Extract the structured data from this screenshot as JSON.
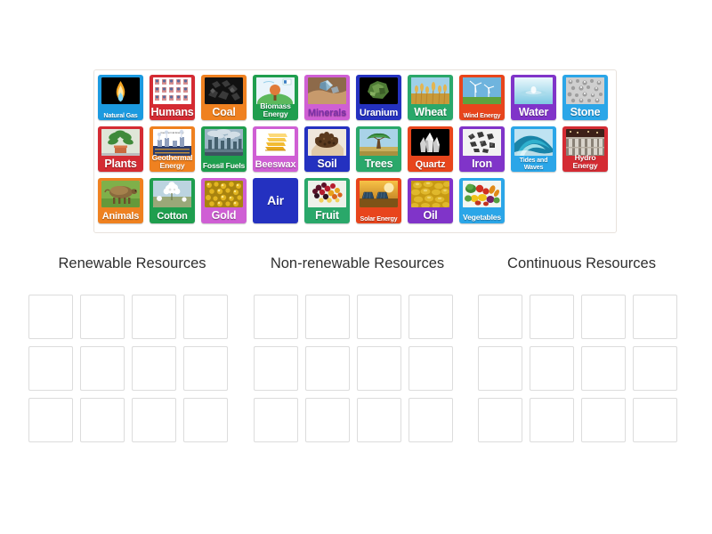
{
  "activity": {
    "type": "group-sort",
    "tray_rows": 3,
    "tray_columns": 10
  },
  "tiles": [
    {
      "label": "Natural Gas",
      "bg": "#1b9ae0",
      "fg": "#ffffff",
      "size": "xs",
      "icon": "gas-flame-icon",
      "row": 0
    },
    {
      "label": "Humans",
      "bg": "#d42b33",
      "fg": "#ffffff",
      "size": "lg",
      "icon": "people-grid-icon",
      "row": 0
    },
    {
      "label": "Coal",
      "bg": "#ef8120",
      "fg": "#ffffff",
      "size": "lg",
      "icon": "coal-lumps-icon",
      "row": 0
    },
    {
      "label": "Biomass Energy",
      "bg": "#1f9e4e",
      "fg": "#ffffff",
      "size": "two",
      "icon": "biomass-diagram-icon",
      "row": 0
    },
    {
      "label": "Minerals",
      "bg": "#cf5fd4",
      "fg": "#7b2fa8",
      "size": "md",
      "icon": "minerals-hand-icon",
      "row": 0
    },
    {
      "label": "Uranium",
      "bg": "#2431c0",
      "fg": "#ffffff",
      "size": "md",
      "icon": "uranium-ore-icon",
      "row": 0
    },
    {
      "label": "Wheat",
      "bg": "#2aa86a",
      "fg": "#ffffff",
      "size": "lg",
      "icon": "wheat-field-icon",
      "row": 0
    },
    {
      "label": "Wind Energy",
      "bg": "#e8451c",
      "fg": "#ffffff",
      "size": "xs",
      "icon": "wind-turbine-icon",
      "row": 0
    },
    {
      "label": "Water",
      "bg": "#8034c9",
      "fg": "#ffffff",
      "size": "lg",
      "icon": "water-drop-icon",
      "row": 0
    },
    {
      "label": "Stone",
      "bg": "#2ba6e8",
      "fg": "#ffffff",
      "size": "lg",
      "icon": "stone-gravel-icon",
      "row": 0
    },
    {
      "label": "Plants",
      "bg": "#d42b33",
      "fg": "#ffffff",
      "size": "lg",
      "icon": "potted-plant-icon",
      "row": 1
    },
    {
      "label": "Geothermal Energy",
      "bg": "#ef8120",
      "fg": "#ffffff",
      "size": "two",
      "icon": "geothermal-plant-icon",
      "row": 1
    },
    {
      "label": "Fossil Fuels",
      "bg": "#1f9e4e",
      "fg": "#ffffff",
      "size": "sm",
      "icon": "smokestacks-icon",
      "row": 1
    },
    {
      "label": "Beeswax",
      "bg": "#cf5fd4",
      "fg": "#ffffff",
      "size": "md",
      "icon": "beeswax-bars-icon",
      "row": 1
    },
    {
      "label": "Soil",
      "bg": "#2431c0",
      "fg": "#ffffff",
      "size": "lg",
      "icon": "soil-hand-icon",
      "row": 1
    },
    {
      "label": "Trees",
      "bg": "#2aa86a",
      "fg": "#ffffff",
      "size": "lg",
      "icon": "acacia-tree-icon",
      "row": 1
    },
    {
      "label": "Quartz",
      "bg": "#e8451c",
      "fg": "#ffffff",
      "size": "md",
      "icon": "quartz-crystal-icon",
      "row": 1
    },
    {
      "label": "Iron",
      "bg": "#8034c9",
      "fg": "#ffffff",
      "size": "lg",
      "icon": "iron-ore-icon",
      "row": 1
    },
    {
      "label": "Tides and Waves",
      "bg": "#2ba6e8",
      "fg": "#ffffff",
      "size": "xs",
      "icon": "ocean-wave-icon",
      "row": 1
    },
    {
      "label": "Hydro Energy",
      "bg": "#d42b33",
      "fg": "#ffffff",
      "size": "two",
      "icon": "hydro-dam-icon",
      "row": 1
    },
    {
      "label": "Animals",
      "bg": "#ef8120",
      "fg": "#ffffff",
      "size": "md",
      "icon": "cow-animal-icon",
      "row": 2
    },
    {
      "label": "Cotton",
      "bg": "#1f9e4e",
      "fg": "#ffffff",
      "size": "md",
      "icon": "cotton-boll-icon",
      "row": 2
    },
    {
      "label": "Gold",
      "bg": "#cf5fd4",
      "fg": "#ffffff",
      "size": "lg",
      "icon": "gold-nuggets-icon",
      "row": 2
    },
    {
      "label": "Air",
      "bg": "#2431c0",
      "fg": "#ffffff",
      "size": "lg",
      "icon": "none",
      "row": 2
    },
    {
      "label": "Fruit",
      "bg": "#2aa86a",
      "fg": "#ffffff",
      "size": "lg",
      "icon": "mixed-berries-icon",
      "row": 2
    },
    {
      "label": "Solar Energy",
      "bg": "#e8451c",
      "fg": "#ffffff",
      "size": "xs",
      "icon": "solar-panel-icon",
      "row": 2
    },
    {
      "label": "Oil",
      "bg": "#8034c9",
      "fg": "#ffffff",
      "size": "lg",
      "icon": "oil-texture-icon",
      "row": 2
    },
    {
      "label": "Vegetables",
      "bg": "#2ba6e8",
      "fg": "#ffffff",
      "size": "sm",
      "icon": "vegetables-icon",
      "row": 2
    }
  ],
  "categories": [
    {
      "title": "Renewable Resources",
      "slots": 12
    },
    {
      "title": "Non-renewable Resources",
      "slots": 12
    },
    {
      "title": "Continuous Resources",
      "slots": 12
    }
  ],
  "colors": {
    "page_background": "#ffffff",
    "tray_border": "#e8e2dc",
    "slot_border": "#dcdcdc",
    "title_text": "#2f2f2f"
  }
}
